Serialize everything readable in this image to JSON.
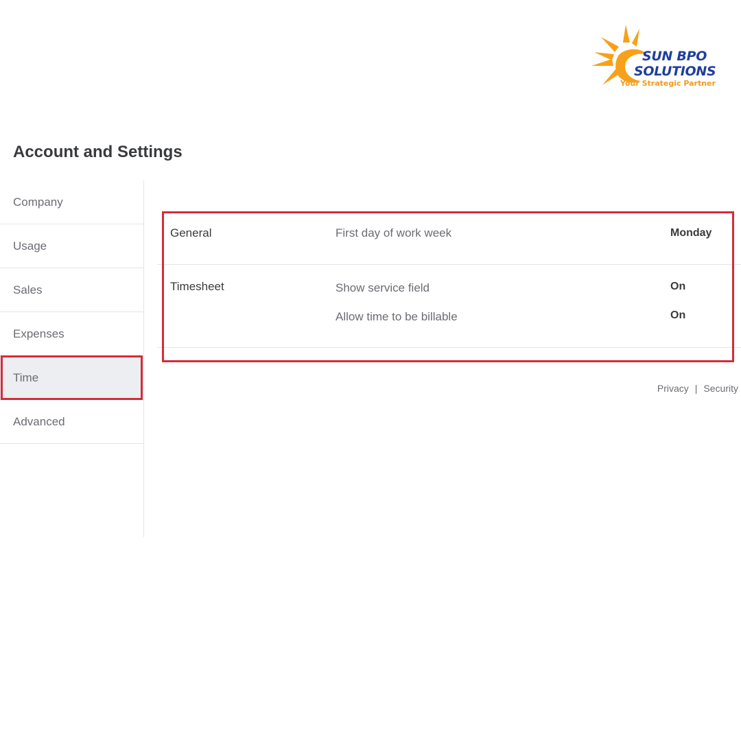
{
  "logo": {
    "line1": "SUN BPO",
    "line2": "SOLUTIONS",
    "tagline": "Your Strategic Partner",
    "colors": {
      "sun": "#f7a11a",
      "text": "#1f3f9e",
      "tagline": "#f39a1d"
    }
  },
  "header": {
    "title": "Account and Settings"
  },
  "sidebar": {
    "items": [
      {
        "label": "Company"
      },
      {
        "label": "Usage"
      },
      {
        "label": "Sales"
      },
      {
        "label": "Expenses"
      },
      {
        "label": "Time",
        "active": true
      },
      {
        "label": "Advanced"
      }
    ]
  },
  "settings": {
    "general": {
      "label": "General",
      "rows": [
        {
          "label": "First day of work week",
          "value": "Monday"
        }
      ]
    },
    "timesheet": {
      "label": "Timesheet",
      "rows": [
        {
          "label": "Show service field",
          "value": "On"
        },
        {
          "label": "Allow time to be billable",
          "value": "On"
        }
      ]
    }
  },
  "footer": {
    "privacy": "Privacy",
    "separator": "|",
    "security": "Security"
  },
  "colors": {
    "highlight": "#d52b39",
    "active_bg": "#eceef1",
    "divider": "#e3e5e8"
  }
}
